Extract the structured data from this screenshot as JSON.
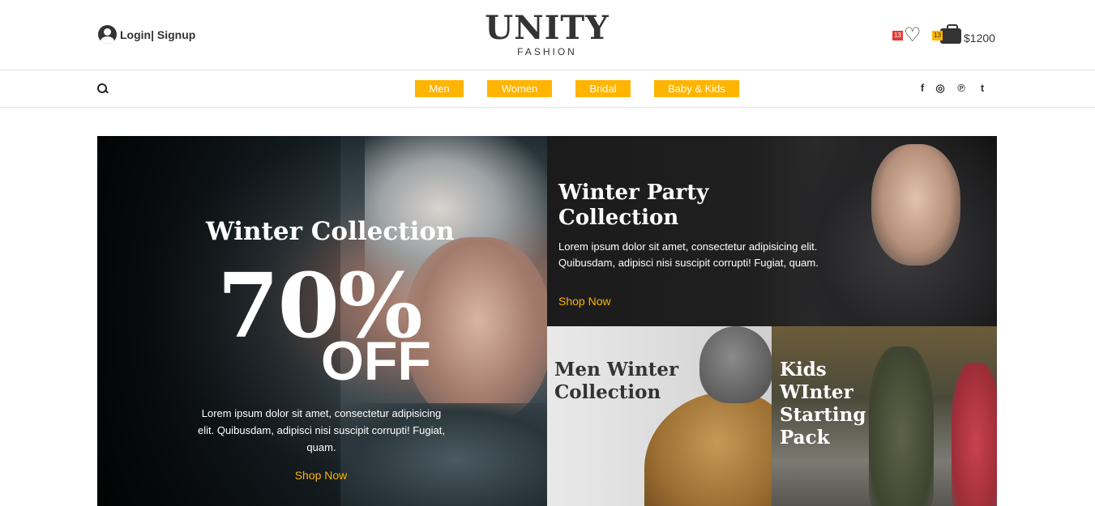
{
  "header": {
    "login_label": "Login| Signup",
    "logo_main": "UNITY",
    "logo_sub": "FASHION",
    "wishlist_count": "13",
    "cart_count": "13",
    "cart_total": "$1200"
  },
  "nav": {
    "items": [
      "Men",
      "Women",
      "Bridal",
      "Baby & Kids"
    ],
    "social": [
      "f",
      "◎",
      "℗",
      "t"
    ]
  },
  "hero": {
    "title": "Winter Collection",
    "percent": "70%",
    "off": "OFF",
    "text": "Lorem ipsum dolor sit amet, consectetur adipisicing elit. Quibusdam, adipisci nisi suscipit corrupti! Fugiat, quam.",
    "shop_label": "Shop Now"
  },
  "party": {
    "title": "Winter Party Collection",
    "text": "Lorem ipsum dolor sit amet, consectetur adipisicing elit. Quibusdam, adipisci nisi suscipit corrupti! Fugiat, quam.",
    "shop_label": "Shop Now"
  },
  "men": {
    "title": "Men Winter Collection"
  },
  "kids": {
    "title": "Kids WInter Starting Pack"
  },
  "colors": {
    "accent": "#ffb400",
    "badge_red": "#e53935",
    "text": "#333333"
  }
}
